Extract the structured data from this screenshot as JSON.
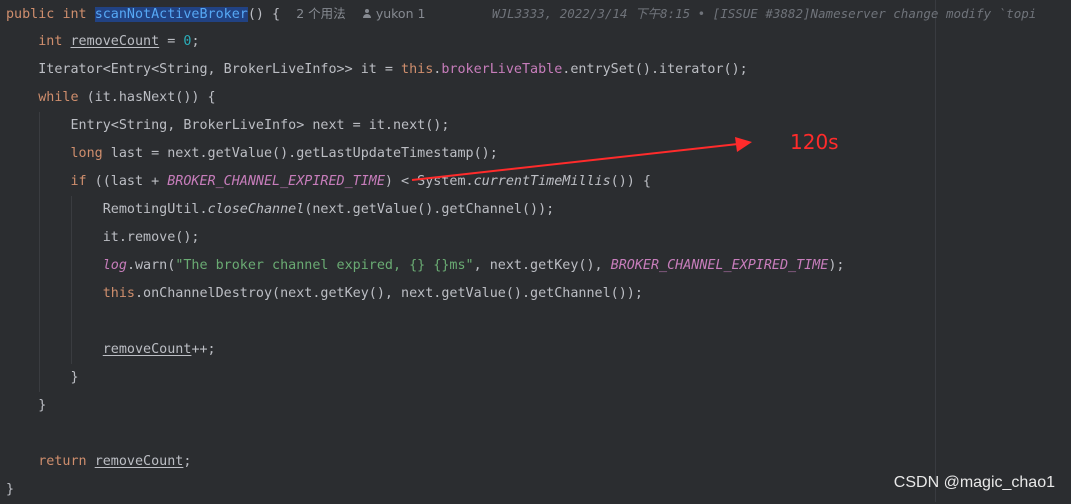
{
  "code": {
    "line1": {
      "kw_public": "public",
      "kw_int": "int",
      "method_name": "scanNotActiveBroker",
      "tail": "() {",
      "usages_hint": "2 个用法",
      "author_hint": "yukon 1",
      "blame": "WJL3333, 2022/3/14 下午8:15 • [ISSUE #3882]Nameserver change modify `topi"
    },
    "line2": {
      "kw": "int",
      "var": "removeCount",
      "eq": " = ",
      "num": "0",
      "end": ";"
    },
    "line3": {
      "pre": "Iterator<Entry<String, BrokerLiveInfo>> it = ",
      "kw_this": "this",
      "dot": ".",
      "field": "brokerLiveTable",
      "post": ".entrySet().iterator();"
    },
    "line4": {
      "kw": "while",
      "post": " (it.hasNext()) {"
    },
    "line5": {
      "text": "Entry<String, BrokerLiveInfo> next = it.next();"
    },
    "line6": {
      "kw": "long",
      "post": " last = next.getValue().getLastUpdateTimestamp();"
    },
    "line7": {
      "kw": "if",
      "pre": " ((last + ",
      "const": "BROKER_CHANNEL_EXPIRED_TIME",
      "mid": ") < System.",
      "static_method": "currentTimeMillis",
      "post": "()) {"
    },
    "line8": {
      "pre": "RemotingUtil.",
      "static_method": "closeChannel",
      "post": "(next.getValue().getChannel());"
    },
    "line9": {
      "text": "it.remove();"
    },
    "line10": {
      "log": "log",
      "pre": ".warn(",
      "str": "\"The broker channel expired, {} {}ms\"",
      "mid": ", next.getKey(), ",
      "const": "BROKER_CHANNEL_EXPIRED_TIME",
      "post": ");"
    },
    "line11": {
      "kw_this": "this",
      "post": ".onChannelDestroy(next.getKey(), next.getValue().getChannel());"
    },
    "line13": {
      "var": "removeCount",
      "post": "++;"
    },
    "line14": {
      "text": "}"
    },
    "line15": {
      "text": "}"
    },
    "line17": {
      "kw": "return",
      "var": "removeCount",
      "end": ";"
    },
    "line18": {
      "text": "}"
    }
  },
  "annotation": {
    "label": "120s",
    "color": "#ff2b2b"
  },
  "watermark": "CSDN @magic_chao1",
  "colors": {
    "background": "#2b2d30",
    "keyword": "#cf8e6d",
    "method": "#56a8f5",
    "field": "#c77dbb",
    "string": "#6aab73",
    "number": "#2aacb8",
    "text": "#bcbec4"
  }
}
